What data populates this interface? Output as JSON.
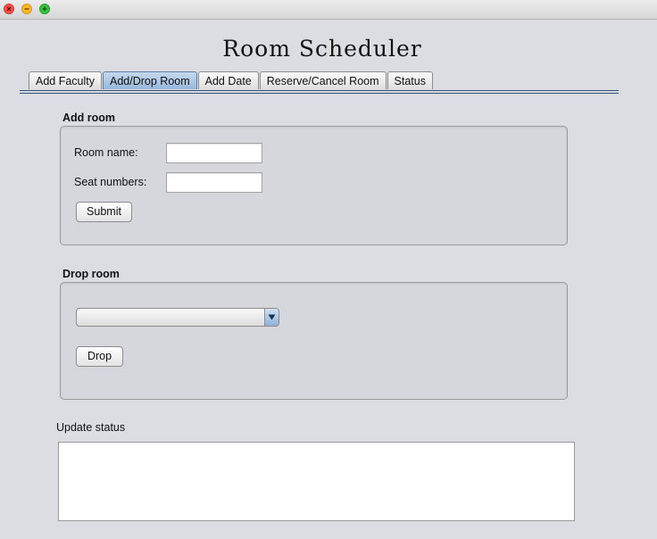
{
  "window": {
    "title": "Room Scheduler",
    "controls": [
      "close-icon",
      "minimize-icon",
      "zoom-icon"
    ]
  },
  "tabs": [
    {
      "label": "Add Faculty",
      "active": false
    },
    {
      "label": "Add/Drop Room",
      "active": true
    },
    {
      "label": "Add Date",
      "active": false
    },
    {
      "label": "Reserve/Cancel Room",
      "active": false
    },
    {
      "label": "Status",
      "active": false
    }
  ],
  "add_room": {
    "title": "Add room",
    "room_name_label": "Room name:",
    "room_name_value": "",
    "seat_numbers_label": "Seat numbers:",
    "seat_numbers_value": "",
    "submit_label": "Submit"
  },
  "drop_room": {
    "title": "Drop room",
    "selected_room": "",
    "drop_label": "Drop"
  },
  "update_status": {
    "label": "Update status",
    "text": ""
  },
  "colors": {
    "background": "#dcdde3",
    "active_tab": "#98b7dc",
    "tab_underline": "#2f4e78"
  }
}
